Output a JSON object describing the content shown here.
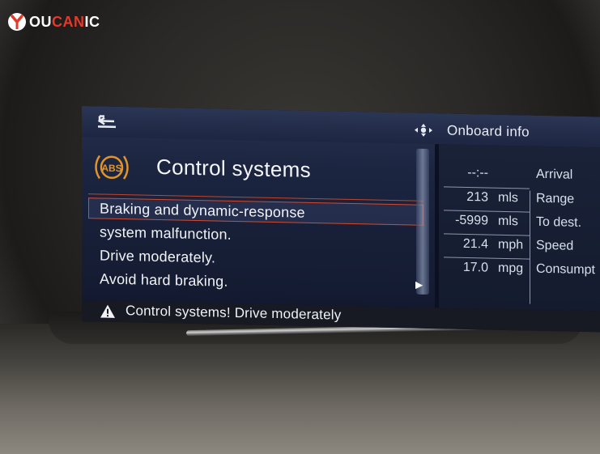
{
  "logo": {
    "prefix": "OU",
    "accent": "CAN",
    "suffix": "IC"
  },
  "topbar": {
    "back_icon": "back-arrow-icon",
    "nav_icon": "controller-direction-icon",
    "right_title": "Onboard info"
  },
  "message": {
    "icon": "abs-warning-icon",
    "title": "Control systems",
    "lines": [
      "Braking and dynamic-response",
      "system malfunction.",
      "Drive moderately.",
      "Avoid hard braking."
    ]
  },
  "onboard_info": {
    "rows": [
      {
        "value": "--:--",
        "unit": "",
        "label": "Arrival"
      },
      {
        "value": "213",
        "unit": "mls",
        "label": "Range"
      },
      {
        "value": "-5999",
        "unit": "mls",
        "label": "To dest."
      },
      {
        "value": "21.4",
        "unit": "mph",
        "label": "Speed"
      },
      {
        "value": "17.0",
        "unit": "mpg",
        "label": "Consumpt"
      }
    ]
  },
  "status_bar": {
    "icon": "warning-triangle-icon",
    "text": "Control systems! Drive moderately"
  },
  "colors": {
    "accent": "#d24a2f",
    "abs_amber": "#e0942a",
    "screen_bg": "#131a30"
  }
}
